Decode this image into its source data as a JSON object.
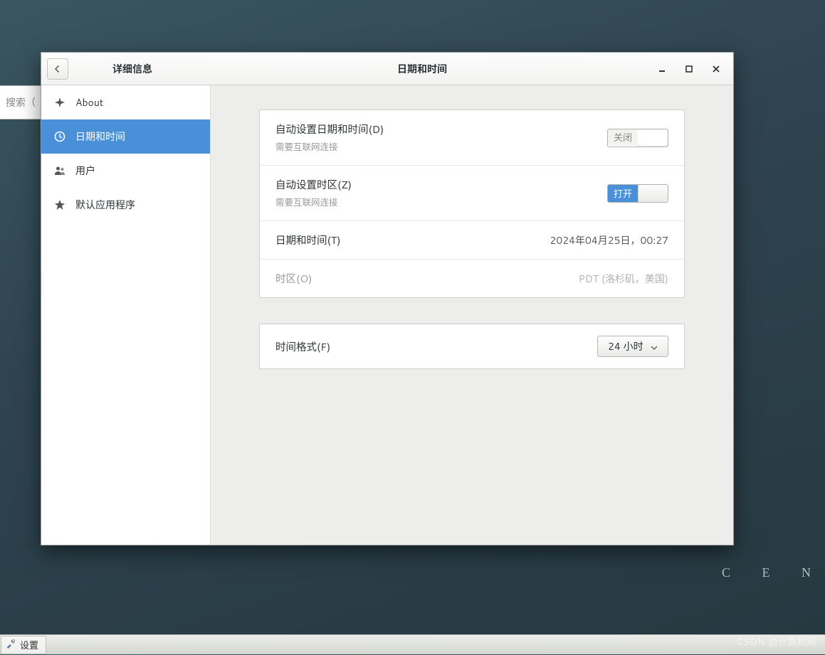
{
  "bg_window": {
    "search_label": "搜索（"
  },
  "taskbar": {
    "settings_label": "设置"
  },
  "watermark": "CSDN @计算机痴",
  "brand_partial": "C  E  N",
  "window": {
    "sidebar_title": "详细信息",
    "page_title": "日期和时间"
  },
  "sidebar": {
    "items": [
      {
        "label": "About"
      },
      {
        "label": "日期和时间"
      },
      {
        "label": "用户"
      },
      {
        "label": "默认应用程序"
      }
    ]
  },
  "settings": {
    "auto_datetime": {
      "title": "自动设置日期和时间(D)",
      "sub": "需要互联网连接"
    },
    "auto_timezone": {
      "title": "自动设置时区(Z)",
      "sub": "需要互联网连接"
    },
    "datetime": {
      "title": "日期和时间(T)",
      "value": "2024年04月25日，00:27"
    },
    "timezone": {
      "title": "时区(O)",
      "value": "PDT (洛杉矶，美国)"
    },
    "format": {
      "title": "时间格式(F)",
      "value": "24 小时"
    }
  },
  "toggle": {
    "off_label": "关闭",
    "on_label": "打开"
  }
}
